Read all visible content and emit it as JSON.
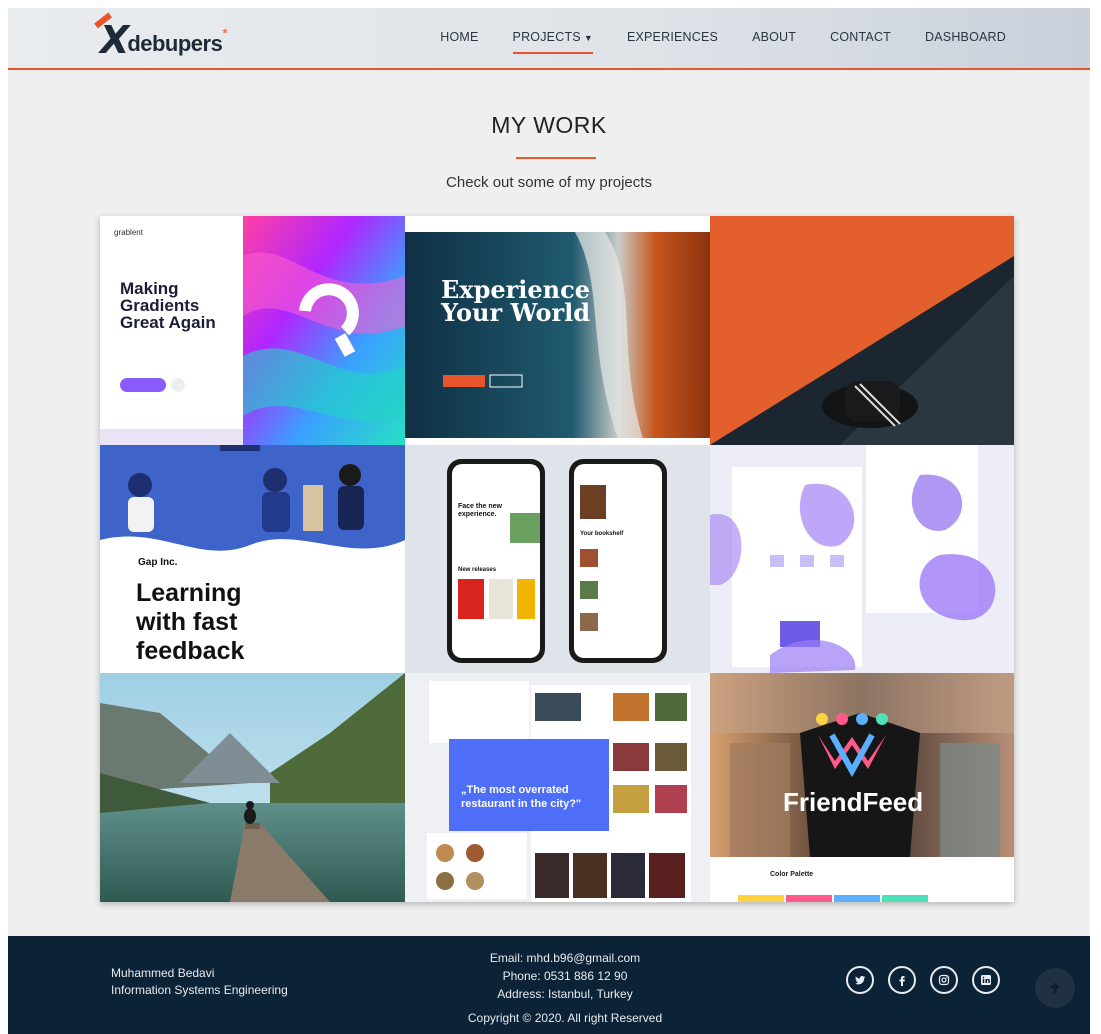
{
  "logo": {
    "mark": "X",
    "word": "debupers",
    "star": "*"
  },
  "nav": {
    "items": [
      {
        "label": "HOME"
      },
      {
        "label": "PROJECTS"
      },
      {
        "label": "EXPERIENCES"
      },
      {
        "label": "ABOUT"
      },
      {
        "label": "CONTACT"
      },
      {
        "label": "DASHBOARD"
      }
    ],
    "active": "PROJECTS"
  },
  "section": {
    "title": "MY WORK",
    "subtitle": "Check out some of my projects"
  },
  "projects": {
    "tile1": {
      "brand": "grablent",
      "heading1": "Making",
      "heading2": "Gradients",
      "heading3": "Great Again"
    },
    "tile2": {
      "heading1": "Experience",
      "heading2": "Your World"
    },
    "tile4": {
      "company": "Gap Inc.",
      "heading1": "Learning",
      "heading2": "with fast",
      "heading3": "feedback"
    },
    "tile5": {
      "left_title": "Face the new experience.",
      "releases": "New releases",
      "bookshelf": "Your bookshelf"
    },
    "tile8": {
      "quote1": "„The most overrated",
      "quote2": "restaurant in the city?\""
    },
    "tile9": {
      "name": "FriendFeed",
      "palette": "Color Palette"
    }
  },
  "footer": {
    "name": "Muhammed Bedavi",
    "role": "Information Systems Engineering",
    "email": "Email: mhd.b96@gmail.com",
    "phone": "Phone: 0531 886 12 90",
    "address": "Address: Istanbul, Turkey",
    "copyright": "Copyright © 2020. All right Reserved"
  },
  "colors": {
    "accent": "#e8552a",
    "footer_bg": "#0c2236"
  },
  "icons": [
    "twitter-icon",
    "facebook-icon",
    "instagram-icon",
    "linkedin-icon",
    "arrow-up-icon"
  ]
}
